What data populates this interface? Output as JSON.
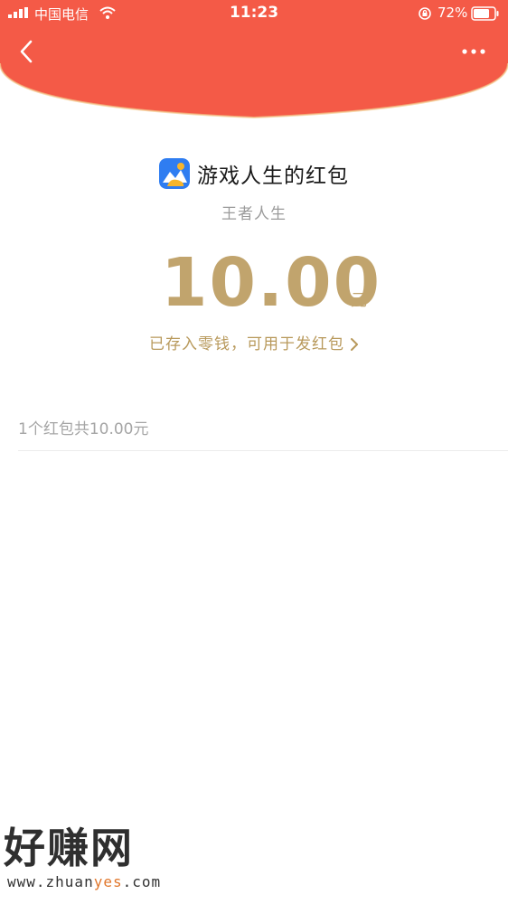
{
  "status_bar": {
    "carrier": "中国电信",
    "time": "11:23",
    "battery_percent": "72%"
  },
  "header": {
    "back_icon": "chevron-left-icon",
    "more_icon": "more-dots-icon",
    "color": "#f45a47"
  },
  "red_packet": {
    "title": "游戏人生的红包",
    "subtitle": "王者人生",
    "amount": "10.00",
    "unit": "元",
    "stored_text": "已存入零钱，可用于发红包",
    "accent_color": "#c1a46d"
  },
  "summary": {
    "text": "1个红包共10.00元"
  },
  "watermark": {
    "brand": "好赚网",
    "url_prefix": "www.zhuan",
    "url_accent": "yes",
    "url_suffix": ".com"
  }
}
